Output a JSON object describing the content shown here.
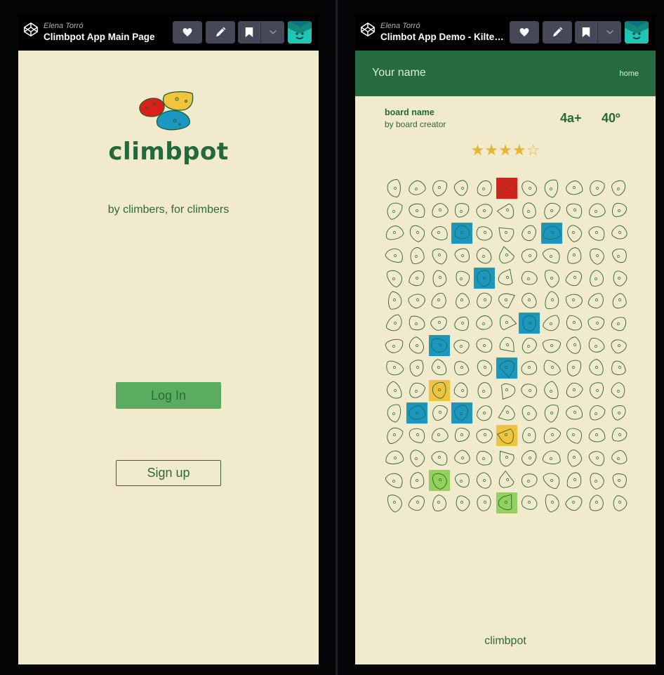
{
  "left_pen": {
    "author": "Elena Torró",
    "title": "Climbpot App Main Page"
  },
  "right_pen": {
    "author": "Elena Torró",
    "title": "Climbot App Demo - Kiltebots"
  },
  "toolbar_icons": [
    "codepen-logo-icon",
    "heart-icon",
    "pencil-icon",
    "bookmark-icon",
    "chevron-down-icon",
    "avatar-icon"
  ],
  "main_page": {
    "brand": "climbpot",
    "tagline": "by climbers, for climbers",
    "login_label": "Log In",
    "signup_label": "Sign up"
  },
  "demo_page": {
    "user_name": "Your name",
    "home_link": "home",
    "board_name": "board name",
    "board_creator": "by board creator",
    "grade": "4a+",
    "angle": "40º",
    "rating": 4,
    "rating_max": 5,
    "footer": "climbpot"
  },
  "board": {
    "cols": 11,
    "rows": 15,
    "highlighted_holds": [
      {
        "row": 1,
        "col": 6,
        "color": "red"
      },
      {
        "row": 3,
        "col": 4,
        "color": "blue"
      },
      {
        "row": 3,
        "col": 8,
        "color": "blue"
      },
      {
        "row": 5,
        "col": 5,
        "color": "blue"
      },
      {
        "row": 7,
        "col": 7,
        "color": "blue"
      },
      {
        "row": 8,
        "col": 3,
        "color": "blue"
      },
      {
        "row": 9,
        "col": 6,
        "color": "blue"
      },
      {
        "row": 10,
        "col": 3,
        "color": "yellow"
      },
      {
        "row": 11,
        "col": 2,
        "color": "blue"
      },
      {
        "row": 11,
        "col": 4,
        "color": "blue"
      },
      {
        "row": 12,
        "col": 6,
        "color": "yellow"
      },
      {
        "row": 14,
        "col": 3,
        "color": "green"
      },
      {
        "row": 15,
        "col": 6,
        "color": "green"
      }
    ]
  },
  "colors": {
    "app_bg": "#f1eacc",
    "primary_green": "#246c40",
    "login_green": "#5aac5e",
    "hold_red": "#dd1f19",
    "hold_blue": "#1a98c2",
    "hold_yellow": "#f2c33c",
    "hold_green": "#93d05c",
    "star_gold": "#e6b534"
  }
}
